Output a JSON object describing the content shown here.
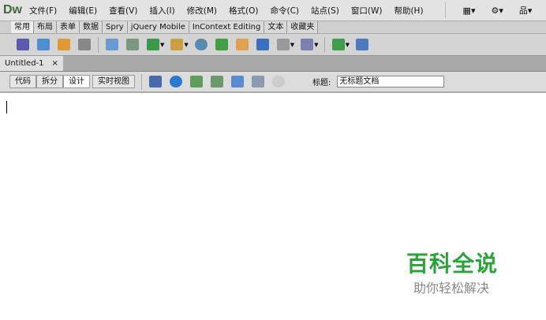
{
  "app": {
    "logo": "Dw"
  },
  "menu": [
    "文件(F)",
    "编辑(E)",
    "查看(V)",
    "插入(I)",
    "修改(M)",
    "格式(O)",
    "命令(C)",
    "站点(S)",
    "窗口(W)",
    "帮助(H)"
  ],
  "menu_tools": [
    "▦▾",
    "⚙▾",
    "品▾"
  ],
  "insert_tabs": [
    "常用",
    "布局",
    "表单",
    "数据",
    "Spry",
    "jQuery Mobile",
    "InContext Editing",
    "文本",
    "收藏夹"
  ],
  "document": {
    "tab": "Untitled-1",
    "close": "×"
  },
  "view_buttons": [
    "代码",
    "拆分",
    "设计",
    "实时视图"
  ],
  "title_label": "标题:",
  "title_value": "无标题文档",
  "watermark": {
    "title": "百科全说",
    "subtitle": "助你轻松解决"
  }
}
